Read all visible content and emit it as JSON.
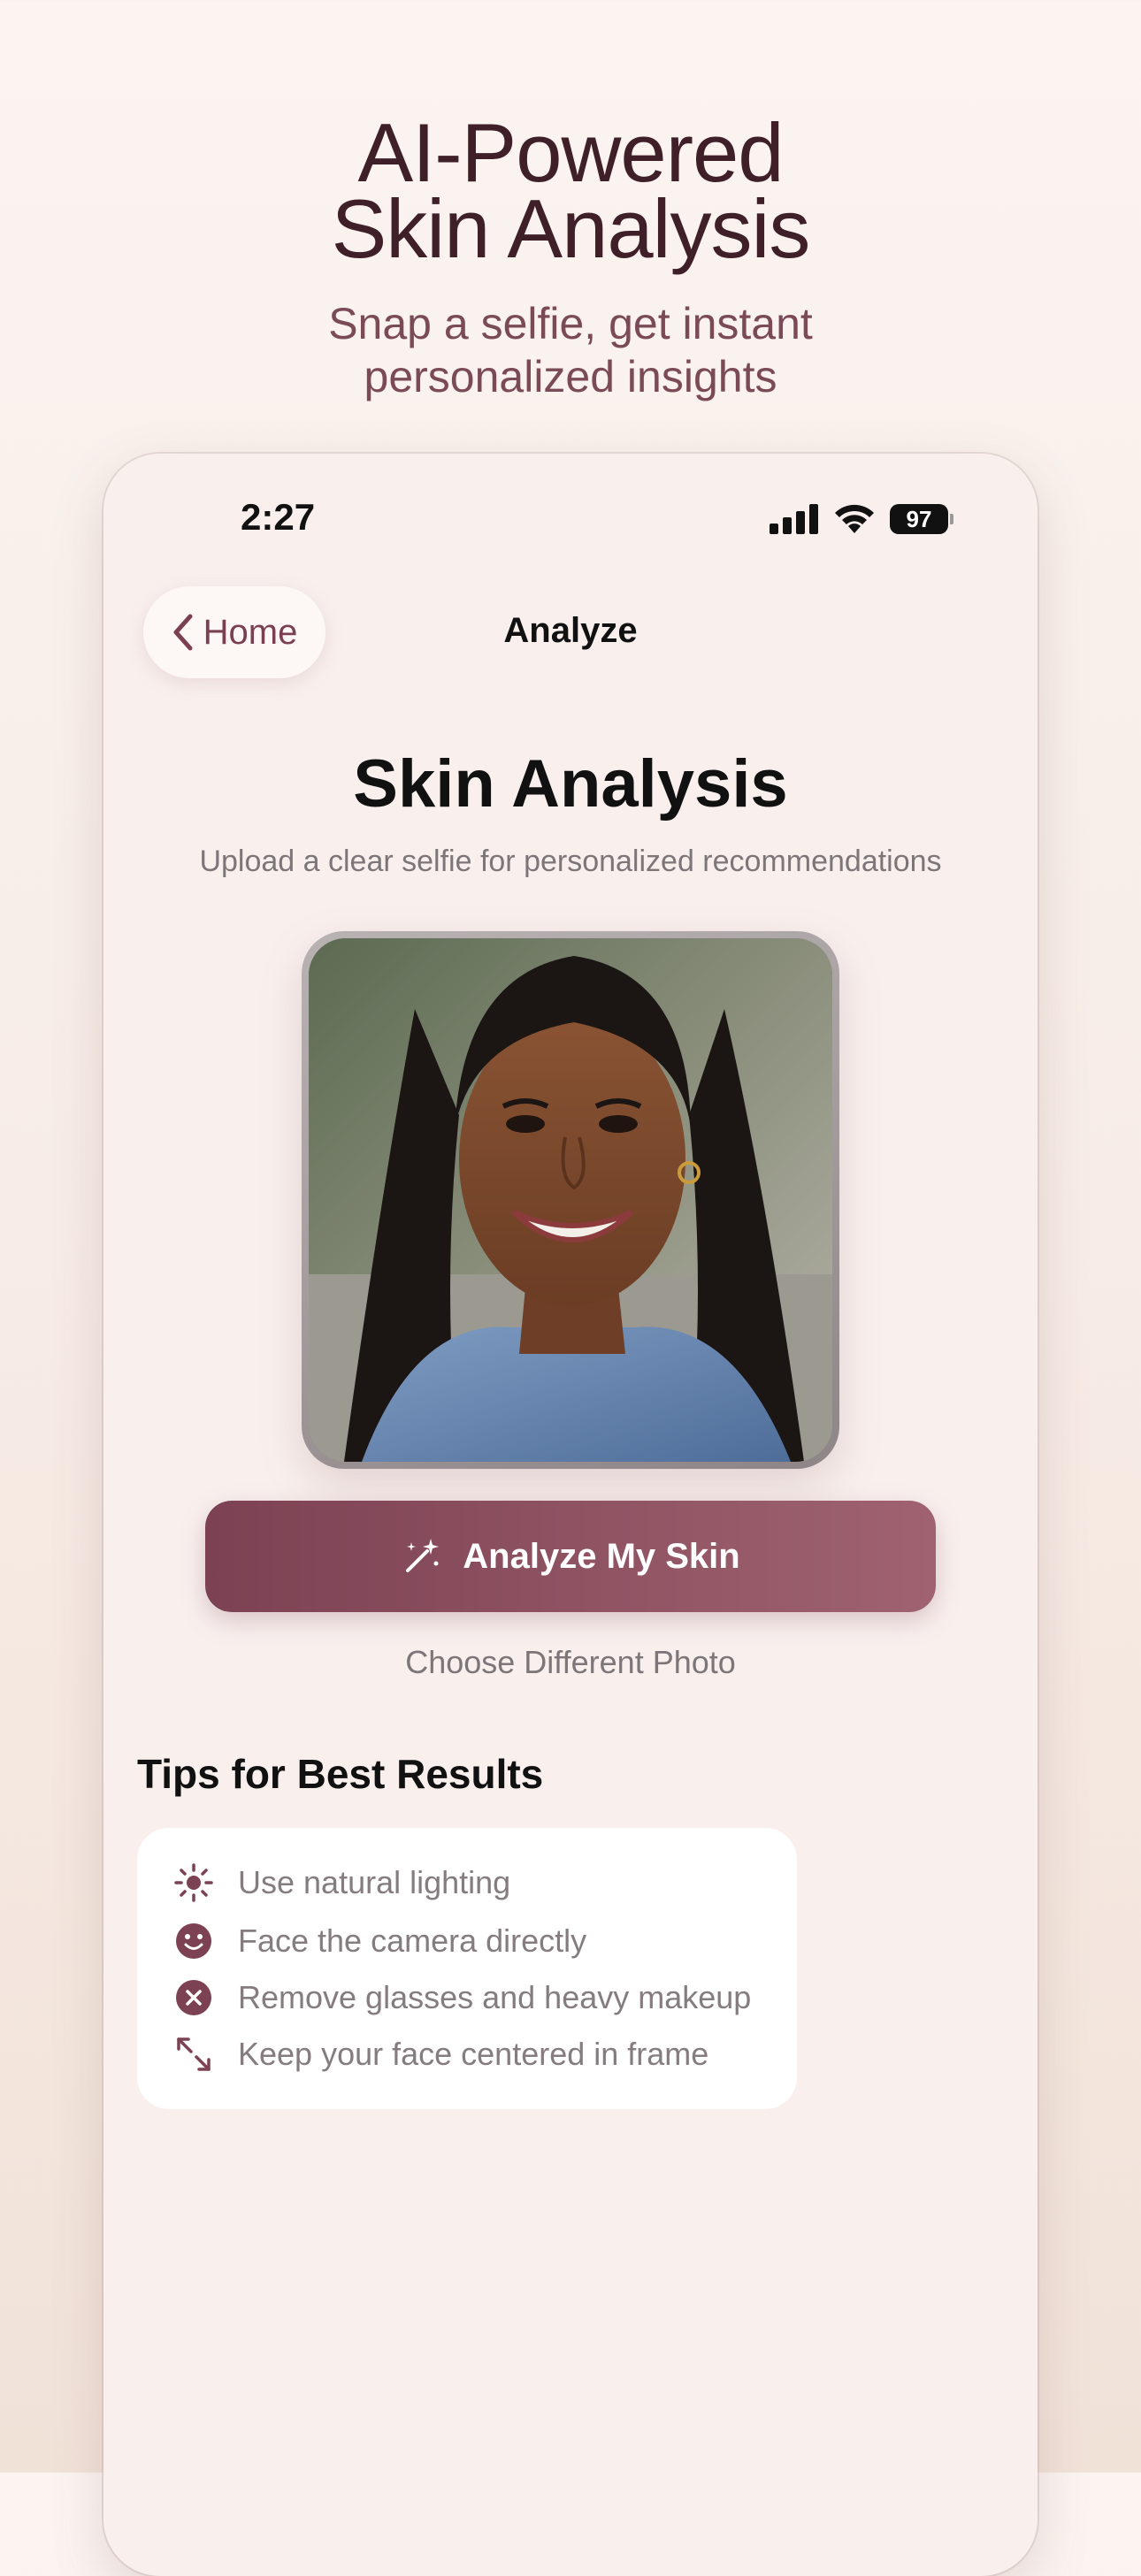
{
  "hero": {
    "title_line1": "AI-Powered",
    "title_line2": "Skin Analysis",
    "subtitle_line1": "Snap a selfie, get instant",
    "subtitle_line2": "personalized insights"
  },
  "status_bar": {
    "time": "2:27",
    "battery": "97",
    "icons": [
      "cellular-signal-icon",
      "wifi-icon",
      "battery-icon"
    ]
  },
  "nav": {
    "back_label": "Home",
    "back_icon": "chevron-left-icon",
    "title": "Analyze"
  },
  "page": {
    "title": "Skin Analysis",
    "subtitle": "Upload a clear selfie for personalized recommendations"
  },
  "photo": {
    "alt": "Selfie of smiling woman with braids in denim jacket"
  },
  "actions": {
    "analyze_label": "Analyze My Skin",
    "analyze_icon": "magic-wand-icon",
    "choose_label": "Choose Different Photo"
  },
  "tips": {
    "heading": "Tips for Best Results",
    "items": [
      {
        "icon": "sun-icon",
        "label": "Use natural lighting"
      },
      {
        "icon": "smiley-face-icon",
        "label": "Face the camera directly"
      },
      {
        "icon": "x-circle-icon",
        "label": "Remove glasses and heavy makeup"
      },
      {
        "icon": "expand-arrows-icon",
        "label": "Keep your face centered in frame"
      }
    ]
  },
  "colors": {
    "accent": "#7c4253",
    "accent_light": "#a06270",
    "hero_title": "#3f1f28",
    "hero_subtitle": "#7a4a57",
    "muted_text": "#7d7679",
    "phone_bg": "#f9f0ee"
  }
}
